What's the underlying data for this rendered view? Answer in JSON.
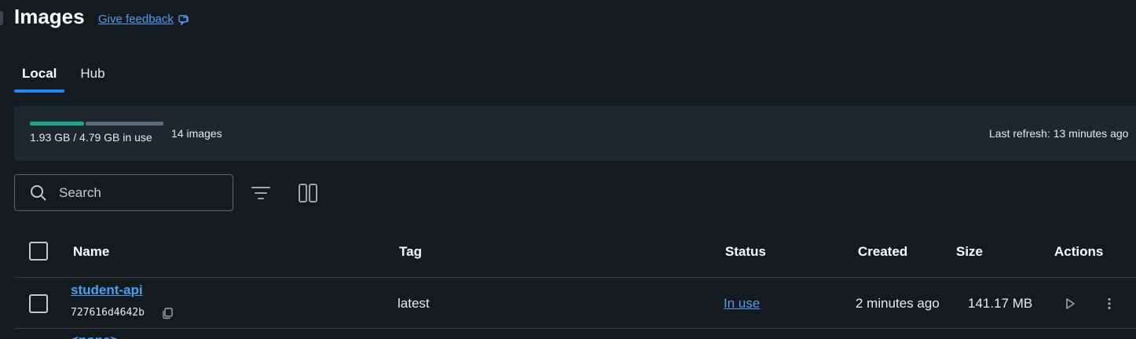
{
  "page": {
    "title": "Images",
    "feedback_label": "Give feedback"
  },
  "tabs": [
    {
      "label": "Local",
      "active": true
    },
    {
      "label": "Hub",
      "active": false
    }
  ],
  "storage": {
    "usage_text": "1.93 GB / 4.79 GB in use",
    "used_fraction": 0.403,
    "image_count": "14 images",
    "last_refresh": "Last refresh: 13 minutes ago",
    "colors": {
      "used": "#1aa58c",
      "free": "#5b6b7a"
    }
  },
  "search": {
    "placeholder": "Search",
    "value": ""
  },
  "toolbar": {
    "filter_icon": "filter-icon",
    "columns_icon": "columns-icon"
  },
  "table": {
    "columns": [
      "Name",
      "Tag",
      "Status",
      "Created",
      "Size",
      "Actions"
    ],
    "rows": [
      {
        "name": "student-api",
        "id": "727616d4642b",
        "tag": "latest",
        "status": "In use",
        "created": "2 minutes ago",
        "size": "141.17 MB"
      }
    ],
    "next_row_partial": "<none>"
  },
  "accent": "#1d8af5",
  "link_color": "#4d9ef7"
}
